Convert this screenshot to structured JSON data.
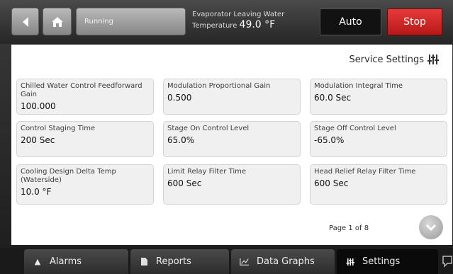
{
  "header": {
    "status": "Running",
    "evaporator_label": "Evaporator Leaving Water",
    "evaporator_label2": "Temperature",
    "evaporator_value": "49.0 °F",
    "auto_label": "Auto",
    "stop_label": "Stop"
  },
  "section": {
    "title": "Service Settings",
    "icon": "sliders-icon"
  },
  "settings": [
    {
      "label": "Chilled Water Control Feedforward Gain",
      "value": "100.000"
    },
    {
      "label": "Modulation Proportional Gain",
      "value": "0.500"
    },
    {
      "label": "Modulation Integral Time",
      "value": "60.0 Sec"
    },
    {
      "label": "Control Staging Time",
      "value": "200 Sec"
    },
    {
      "label": "Stage On Control Level",
      "value": "65.0%"
    },
    {
      "label": "Stage Off Control Level",
      "value": "-65.0%"
    },
    {
      "label": "Cooling Design Delta Temp (Waterside)",
      "value": "10.0 °F"
    },
    {
      "label": "Limit Relay Filter Time",
      "value": "600 Sec"
    },
    {
      "label": "Head Relief Relay Filter Time",
      "value": "600 Sec"
    }
  ],
  "pagination": {
    "text": "Page 1 of 8"
  },
  "nav": {
    "alarms": "Alarms",
    "reports": "Reports",
    "data_graphs": "Data Graphs",
    "settings": "Settings"
  },
  "colors": {
    "stop": "#d42a2a",
    "active_tab": "#0a0a0a"
  }
}
